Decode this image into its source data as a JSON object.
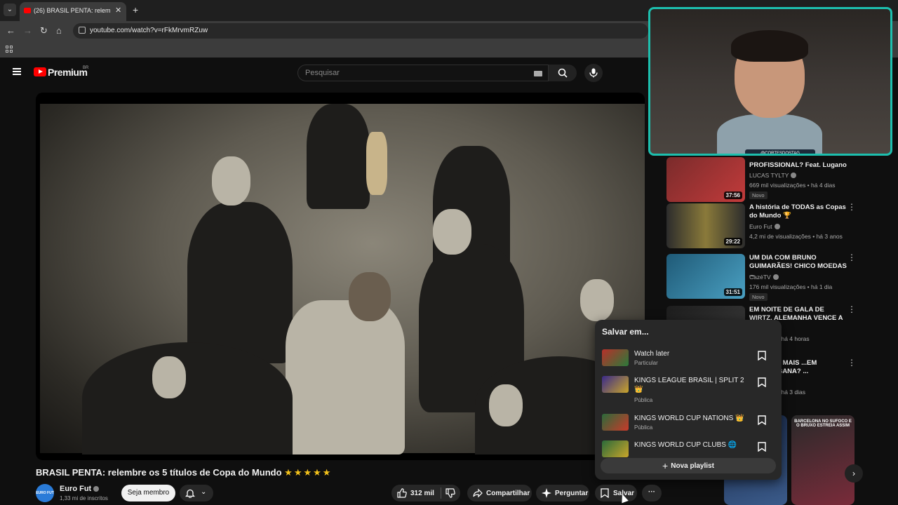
{
  "browser": {
    "tab_title": "(26) BRASIL PENTA: relembre o...",
    "url": "youtube.com/watch?v=rFkMrvmRZuw"
  },
  "yt": {
    "logo_text": "Premium",
    "logo_sup": "BR",
    "search_placeholder": "Pesquisar"
  },
  "overlay": {
    "cam_tag": "@CORTESDOSTAG"
  },
  "video": {
    "title": "BRASIL PENTA: relembre os 5 títulos de Copa do Mundo",
    "title_emoji": "★★★★★",
    "channel": "Euro Fut",
    "channel_avatar_text": "EURO FUT",
    "subs": "1,33 mi de inscritos",
    "join_label": "Seja membro",
    "likes": "312 mil",
    "share_label": "Compartilhar",
    "ask_label": "Perguntar",
    "save_label": "Salvar",
    "more_label": "···"
  },
  "recommendations": [
    {
      "title": "PROFISSIONAL? Feat. Lugano",
      "channel": "LUCAS TYLTY",
      "stats": "669 mil visualizações • há 4 dias",
      "badge": "Novo",
      "duration": "37:56",
      "thumb_a": "#7a2b2b",
      "thumb_b": "#c23b3b"
    },
    {
      "title": "A história de TODAS as Copas do Mundo 🏆",
      "channel": "Euro Fut",
      "stats": "4,2 mi de visualizações • há 3 anos",
      "badge": "",
      "duration": "29:22",
      "thumb_a": "#2c2c2c",
      "thumb_b": "#7a6a3a"
    },
    {
      "title": "UM DIA COM BRUNO GUIMARÃES! CHICO MOEDAS ...",
      "channel": "CazéTV",
      "stats": "176 mil visualizações • há 1 dia",
      "badge": "Novo",
      "duration": "31:51",
      "thumb_a": "#1f5a77",
      "thumb_b": "#4aa0c2"
    },
    {
      "title": "EM NOITE DE GALA DE WIRTZ, ALEMANHA VENCE A SUÍÇA ...",
      "channel": "",
      "stats": "...lizações • há 4 horas",
      "badge": "",
      "duration": "",
      "thumb_a": "#1d1d1d",
      "thumb_b": "#3a3a3a"
    },
    {
      "title": "...OCARIA MAIS ...EM COPACABANA? ...",
      "channel": "",
      "stats": "...lizações • há 3 dias",
      "badge": "",
      "duration": "",
      "thumb_a": "#1d1d1d",
      "thumb_b": "#3a3a3a"
    }
  ],
  "shorts": [
    {
      "text": "",
      "a": "#1a2a4a",
      "b": "#3b5b8a"
    },
    {
      "text": "BARCELONA NO SUFOCO E O BRUXO ESTREIA ASSIM",
      "a": "#2a2a2a",
      "b": "#7a2b3a"
    }
  ],
  "save_popup": {
    "title": "Salvar em...",
    "playlists": [
      {
        "name": "Watch later",
        "privacy": "Particular",
        "a": "#b8302a",
        "b": "#2b7a3a"
      },
      {
        "name": "KINGS LEAGUE BRASIL | SPLIT 2 👑",
        "privacy": "Pública",
        "a": "#3a2a8a",
        "b": "#c9a52a"
      },
      {
        "name": "KINGS WORLD CUP NATIONS 👑",
        "privacy": "Pública",
        "a": "#2a6a3a",
        "b": "#c93a2a"
      },
      {
        "name": "KINGS WORLD CUP CLUBS 🌐",
        "privacy": "",
        "a": "#2a6a3a",
        "b": "#c9a52a"
      }
    ],
    "new_playlist_label": "Nova playlist"
  }
}
